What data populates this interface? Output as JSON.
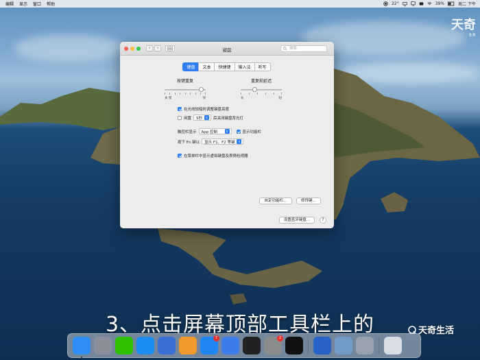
{
  "menubar": {
    "items": [
      "编辑",
      "显示",
      "窗口",
      "帮助"
    ],
    "temp": "22°",
    "battery": "39%",
    "clock": "周二 下午"
  },
  "window": {
    "title": "键盘",
    "search_placeholder": "搜索",
    "tabs": [
      "键盘",
      "文本",
      "快捷键",
      "输入法",
      "听写"
    ],
    "active_tab": 0,
    "key_repeat": {
      "title": "按键重复",
      "left": "关 慢",
      "right": "快",
      "level": 0.88
    },
    "repeat_delay": {
      "title": "重复前延迟",
      "left": "长",
      "right": "短",
      "level": 0.33
    },
    "adjust_brightness": {
      "label": "在光线较暗时调整键盘亮度",
      "checked": true
    },
    "idle": {
      "label": "闲置",
      "value": "5秒",
      "suffix": "后关闭键盘背光灯",
      "checked": false
    },
    "touchbar": {
      "label": "触控栏显示",
      "value": "App 控制",
      "show_strip_label": "显示功能栏",
      "show_strip_checked": true
    },
    "fn_key": {
      "label": "按下 Fn 键以",
      "value": "显示 F1、F2 等键"
    },
    "show_viewer": {
      "label": "在菜单栏中显示虚拟键盘及表情检视器",
      "checked": true
    },
    "buttons": {
      "customize": "自定功能栏…",
      "modifier": "修饰键…",
      "bluetooth": "设置蓝牙键盘…",
      "help": "?"
    }
  },
  "caption": "3、点击屏幕顶部工具栏上的",
  "watermark_top": "天奇",
  "watermark_top_sub": "生活",
  "watermark_bottom": "天奇生活",
  "dock": {
    "items": [
      {
        "name": "finder",
        "color": "#2f8ef5",
        "running": true
      },
      {
        "name": "launchpad",
        "color": "#8a8f99"
      },
      {
        "name": "wechat",
        "color": "#2dc100"
      },
      {
        "name": "safari",
        "color": "#1c8cf0"
      },
      {
        "name": "xcode",
        "color": "#3a6fd8"
      },
      {
        "name": "pages",
        "color": "#f29a2e"
      },
      {
        "name": "app-store",
        "color": "#1f87f5",
        "badge": "7"
      },
      {
        "name": "upload",
        "color": "#3c7bea"
      },
      {
        "name": "terminal",
        "color": "#222222"
      },
      {
        "name": "system-preferences",
        "color": "#8b8b8b",
        "badge": "2"
      },
      {
        "name": "qq",
        "color": "#111111"
      },
      {
        "name": "quicktime",
        "color": "#2962c9"
      },
      {
        "name": "preview",
        "color": "#6f9bc7"
      },
      {
        "name": "photo-tool",
        "color": "#9aa3ad"
      },
      {
        "name": "trash",
        "color": "#d9dde3"
      }
    ]
  }
}
